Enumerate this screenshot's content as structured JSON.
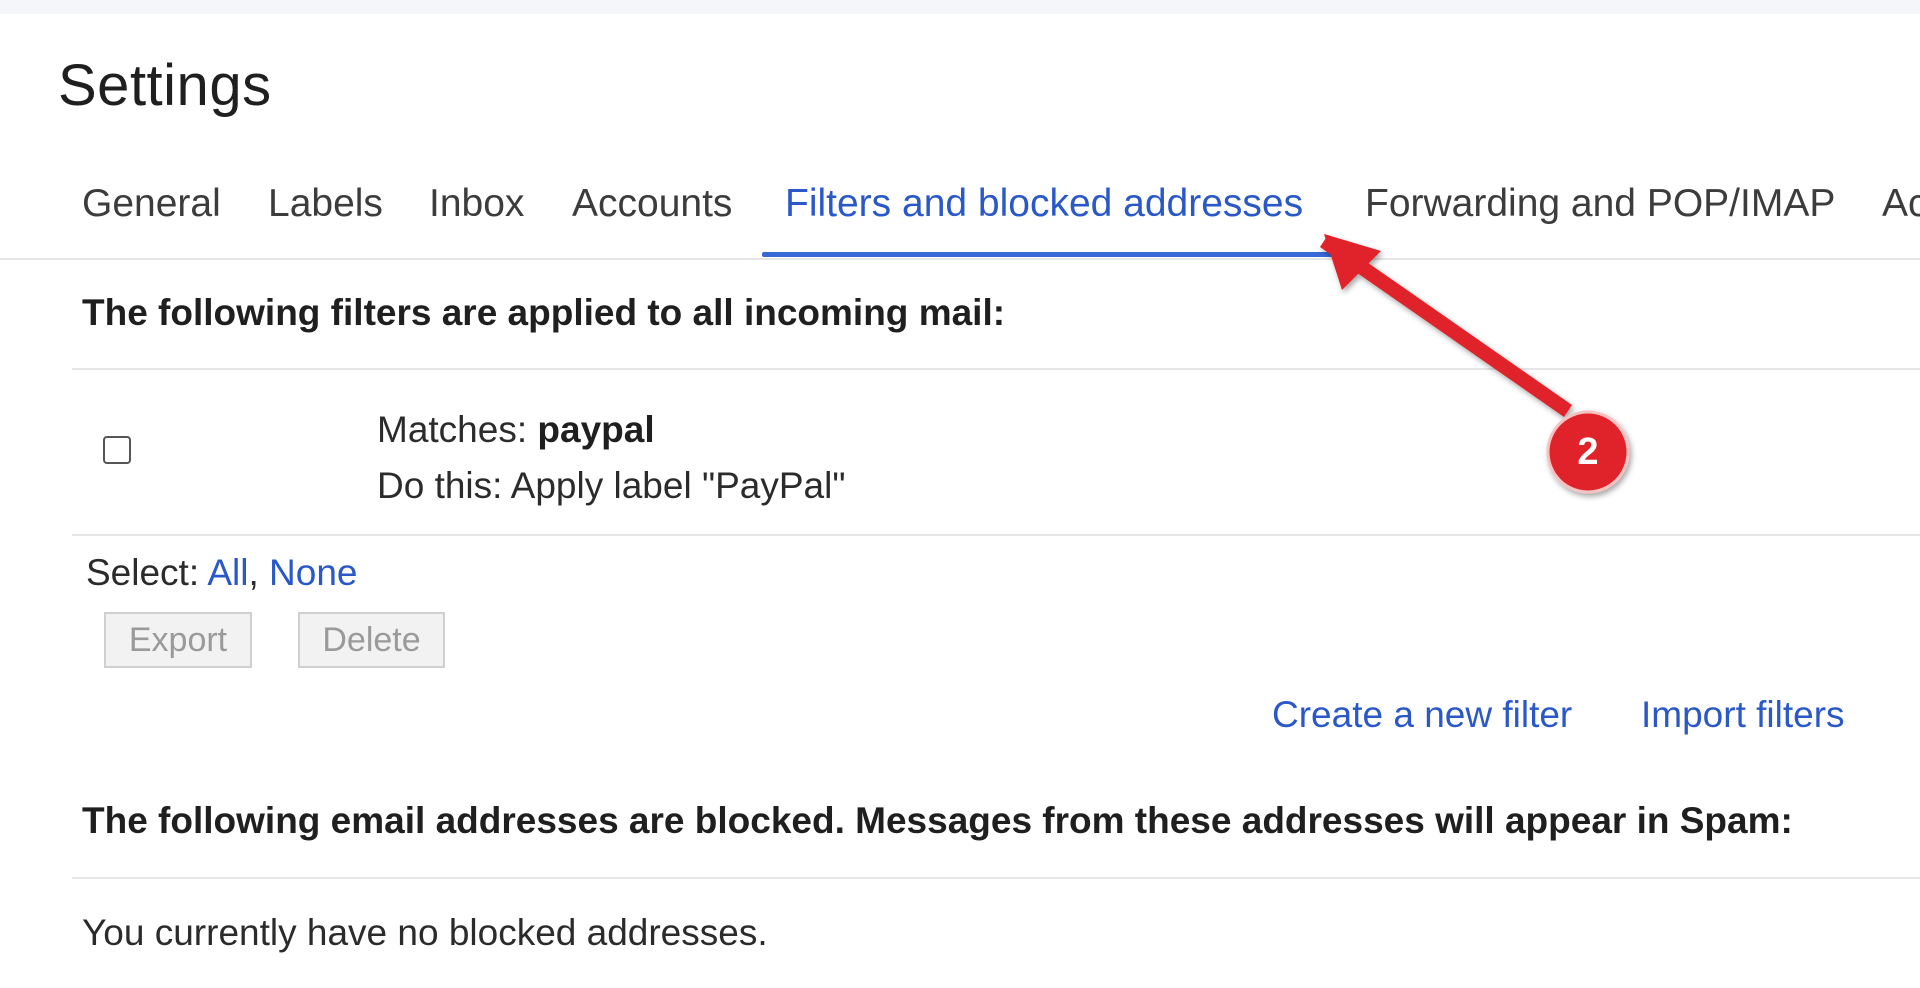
{
  "page": {
    "title": "Settings"
  },
  "tabs": [
    {
      "label": "General"
    },
    {
      "label": "Labels"
    },
    {
      "label": "Inbox"
    },
    {
      "label": "Accounts"
    },
    {
      "label": "Filters and blocked addresses",
      "active": true
    },
    {
      "label": "Forwarding and POP/IMAP"
    },
    {
      "label": "Ac"
    }
  ],
  "filters": {
    "heading": "The following filters are applied to all incoming mail:",
    "rows": [
      {
        "matches_label": "Matches: ",
        "matches_value": "paypal",
        "action_text": "Do this: Apply label \"PayPal\"",
        "checked": false
      }
    ],
    "select_label": "Select: ",
    "select_all": "All",
    "select_separator": ",",
    "select_none": "None",
    "export_label": "Export",
    "delete_label": "Delete",
    "create_filter_label": "Create a new filter",
    "import_filters_label": "Import filters"
  },
  "blocked": {
    "heading": "The following email addresses are blocked. Messages from these addresses will appear in Spam:",
    "empty_text": "You currently have no blocked addresses."
  },
  "annotation": {
    "badge_number": "2",
    "color": "#e0242b"
  },
  "colors": {
    "link": "#2a58c9",
    "active_tab_underline": "#3867d6",
    "text": "#1f1f1f"
  }
}
